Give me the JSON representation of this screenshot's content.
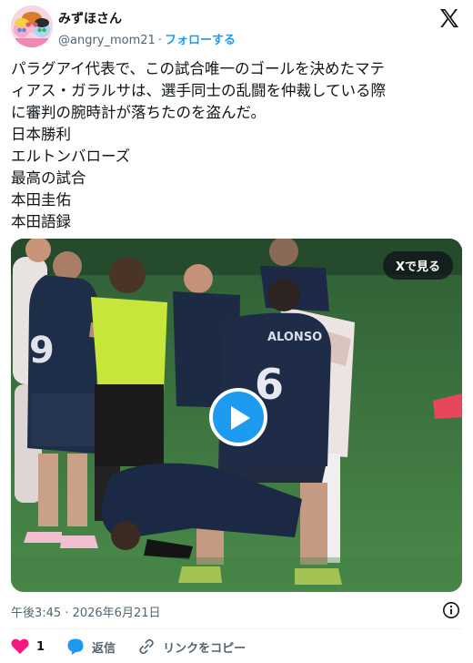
{
  "user": {
    "display_name": "みずほさん",
    "handle": "@angry_mom21",
    "separator": "·",
    "follow_label": "フォローする",
    "avatar_icon": "powerpuff-girls-avatar"
  },
  "tweet": {
    "lines": [
      "パラグアイ代表で、この試合唯一のゴールを決めたマテ",
      "ィアス・ガラルサは、選手同士の乱闘を仲裁している際",
      "に審判の腕時計が落ちたのを盗んだ。",
      "日本勝利",
      "エルトンバローズ",
      "最高の試合",
      "本田圭佑",
      "本田語録"
    ]
  },
  "media": {
    "see_on_x_label": "Xで見る",
    "player_name_back": "ALONSO",
    "player_number_back": "6",
    "player_number_left": "9",
    "play_icon": "play-icon"
  },
  "meta": {
    "timestamp": "午後3:45 · 2026年6月21日"
  },
  "actions": {
    "like_count": "1",
    "reply_label": "返信",
    "copy_link_label": "リンクをコピー"
  },
  "colors": {
    "accent": "#1d9bf0",
    "like": "#f91880",
    "text": "#0f1419",
    "muted": "#536471"
  }
}
